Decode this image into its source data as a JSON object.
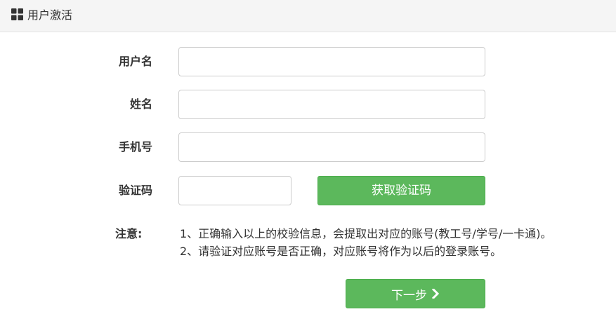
{
  "header": {
    "icon": "grid-icon",
    "title": "用户激活"
  },
  "form": {
    "username": {
      "label": "用户名",
      "value": "",
      "placeholder": ""
    },
    "name": {
      "label": "姓名",
      "value": "",
      "placeholder": ""
    },
    "phone": {
      "label": "手机号",
      "value": "",
      "placeholder": ""
    },
    "captcha": {
      "label": "验证码",
      "value": "",
      "placeholder": "",
      "button_label": "获取验证码"
    }
  },
  "notes": {
    "label": "注意:",
    "lines": [
      "1、正确输入以上的校验信息，会提取出对应的账号(教工号/学号/一卡通)。",
      "2、请验证对应账号是否正确，对应账号将作为以后的登录账号。"
    ]
  },
  "next_button": {
    "label": "下一步",
    "icon": "chevron-right-icon"
  },
  "colors": {
    "primary_green": "#5cb85c",
    "header_bg": "#f5f5f5",
    "input_border": "#cccccc"
  }
}
